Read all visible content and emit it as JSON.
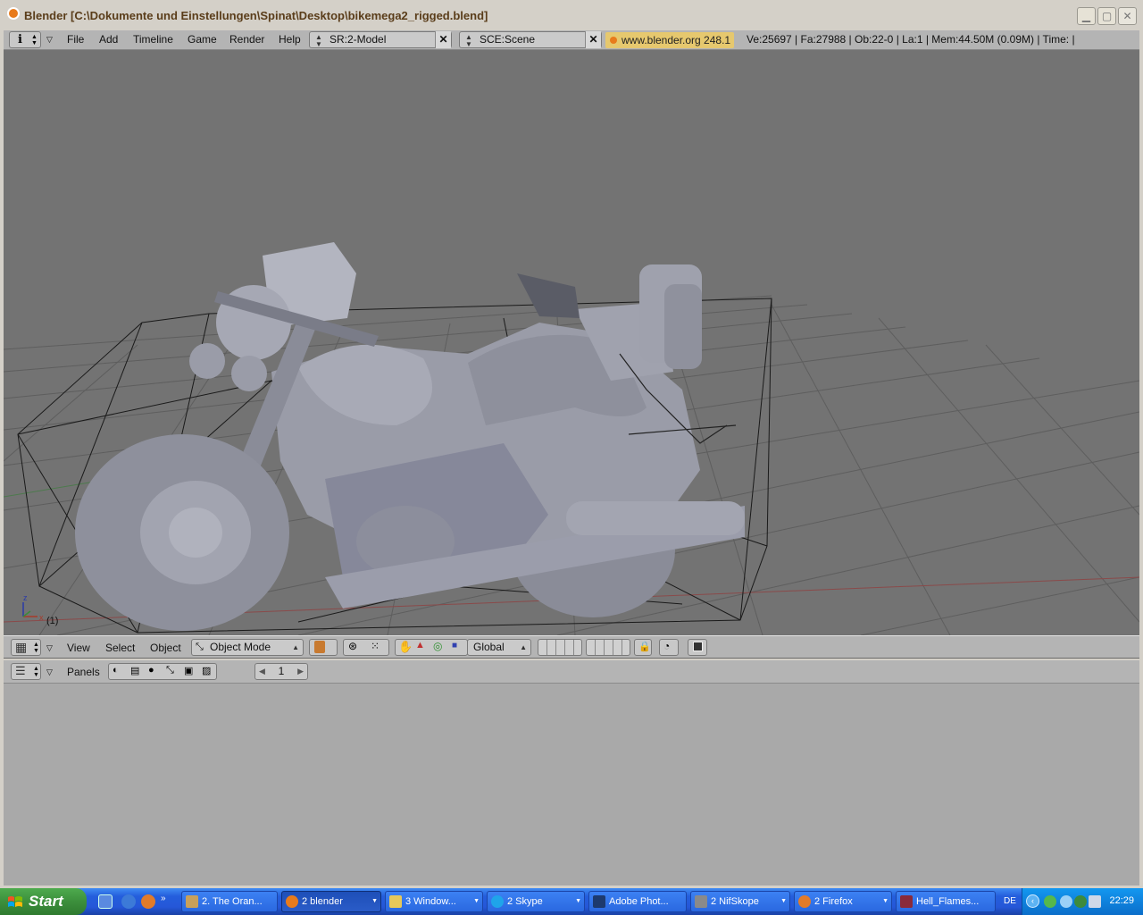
{
  "window": {
    "title": "Blender [C:\\Dokumente und Einstellungen\\Spinat\\Desktop\\bikemega2_rigged.blend]",
    "controls": [
      "minimize",
      "maximize",
      "close"
    ]
  },
  "header": {
    "menus": [
      "File",
      "Add",
      "Timeline",
      "Game",
      "Render",
      "Help"
    ],
    "screen_field": "SR:2-Model",
    "scene_field": "SCE:Scene",
    "website": "www.blender.org 248.1",
    "stats": "Ve:25697 | Fa:27988 | Ob:22-0 | La:1  | Mem:44.50M (0.09M)  | Time: |"
  },
  "viewport": {
    "frame_label": "(1)",
    "axis_labels": {
      "z": "z",
      "x": "x"
    },
    "colors": {
      "background": "#737373",
      "grid": "#5e5e5e",
      "model": "#9a9ca8"
    }
  },
  "viewport_toolbar": {
    "menus": [
      "View",
      "Select",
      "Object"
    ],
    "mode": "Object Mode",
    "orientation": "Global"
  },
  "buttons_window": {
    "panels_label": "Panels",
    "frame_number": "1"
  },
  "taskbar": {
    "start_label": "Start",
    "tasks": [
      {
        "label": "2. The Oran...",
        "active": false
      },
      {
        "label": "2 blender",
        "active": true
      },
      {
        "label": "3 Window...",
        "active": false
      },
      {
        "label": "2 Skype",
        "active": false
      },
      {
        "label": "Adobe Phot...",
        "active": false
      },
      {
        "label": "2 NifSkope",
        "active": false
      },
      {
        "label": "2 Firefox",
        "active": false
      },
      {
        "label": "Hell_Flames...",
        "active": false
      }
    ],
    "language": "DE",
    "clock": "22:29"
  }
}
